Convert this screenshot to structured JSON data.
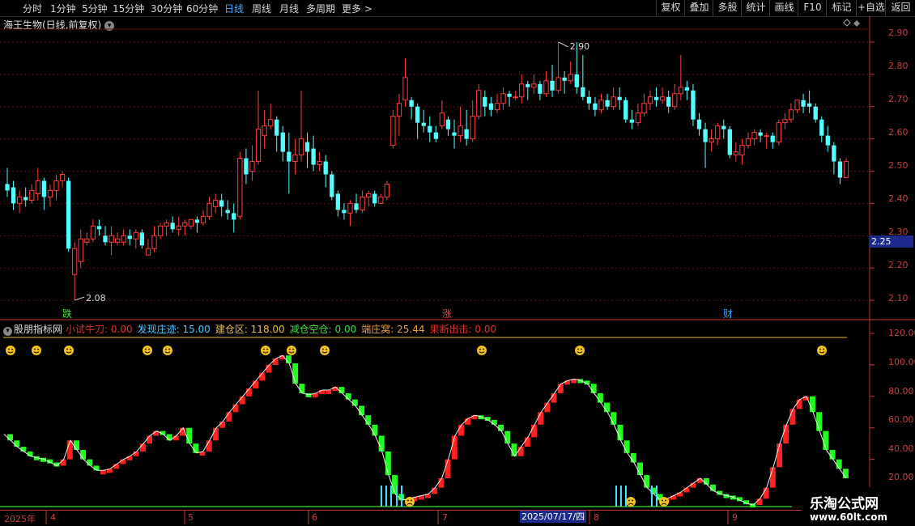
{
  "toolbar": {
    "periods": [
      "分时",
      "1分钟",
      "5分钟",
      "15分钟",
      "30分钟",
      "60分钟",
      "日线",
      "周线",
      "月线",
      "多周期",
      "更多 >"
    ],
    "active_period": "日线",
    "right_buttons": [
      "复权",
      "叠加",
      "多股",
      "统计",
      "画线",
      "F10",
      "标记",
      "+自选",
      "返回"
    ]
  },
  "stock_title": "海王生物(日线,前复权)",
  "price_axis": {
    "labels": [
      "2.90",
      "2.80",
      "2.70",
      "2.60",
      "2.50",
      "2.40",
      "2.30",
      "2.20",
      "2.10"
    ],
    "current_price": "2.25",
    "high_annotation": "2.90",
    "low_annotation": "2.08"
  },
  "markers": {
    "die": "跌",
    "zhang": "涨",
    "cai": "财"
  },
  "indicator": {
    "name": "股朋指标网",
    "items": [
      {
        "label": "小试牛刀: 0.00",
        "color": "#e03030"
      },
      {
        "label": "发现庄迹: 15.00",
        "color": "#4ac8ff"
      },
      {
        "label": "建仓区: 118.00",
        "color": "#e8c040"
      },
      {
        "label": "减仓空仓: 0.00",
        "color": "#40e040"
      },
      {
        "label": "端庄窝: 25.44",
        "color": "#e8a040"
      },
      {
        "label": "果断出击: 0.00",
        "color": "#e03030"
      }
    ],
    "axis_labels": [
      "120.00",
      "100.00",
      "80.00",
      "60.00",
      "40.00",
      "20.00"
    ]
  },
  "date_axis": {
    "labels": [
      "2025年",
      "4",
      "5",
      "6",
      "7",
      "8",
      "9"
    ],
    "highlight": "2025/07/17/四"
  },
  "watermark": {
    "line1": "乐淘公式网",
    "line2": "www.60lt.com"
  },
  "colors": {
    "up": "#ff3c3c",
    "down": "#54ffff",
    "bg": "#000000",
    "grid": "#5a1010",
    "ind_up": "#ff2020",
    "ind_down": "#20ff20"
  },
  "chart_data": {
    "type": "candlestick",
    "ylim": [
      2.06,
      2.94
    ],
    "candles": [
      [
        2.46,
        2.44,
        2.51,
        2.42
      ],
      [
        2.45,
        2.4,
        2.47,
        2.38
      ],
      [
        2.4,
        2.42,
        2.44,
        2.37
      ],
      [
        2.42,
        2.41,
        2.45,
        2.39
      ],
      [
        2.41,
        2.44,
        2.46,
        2.4
      ],
      [
        2.43,
        2.47,
        2.51,
        2.41
      ],
      [
        2.47,
        2.42,
        2.48,
        2.38
      ],
      [
        2.42,
        2.44,
        2.46,
        2.39
      ],
      [
        2.44,
        2.47,
        2.49,
        2.41
      ],
      [
        2.47,
        2.49,
        2.5,
        2.45
      ],
      [
        2.47,
        2.26,
        2.48,
        2.25
      ],
      [
        2.18,
        2.26,
        2.28,
        2.1
      ],
      [
        2.22,
        2.29,
        2.32,
        2.2
      ],
      [
        2.28,
        2.29,
        2.31,
        2.27
      ],
      [
        2.29,
        2.33,
        2.35,
        2.28
      ],
      [
        2.33,
        2.32,
        2.35,
        2.3
      ],
      [
        2.3,
        2.28,
        2.33,
        2.27
      ],
      [
        2.28,
        2.3,
        2.33,
        2.24
      ],
      [
        2.28,
        2.29,
        2.31,
        2.27
      ],
      [
        2.28,
        2.3,
        2.32,
        2.27
      ],
      [
        2.3,
        2.29,
        2.32,
        2.27
      ],
      [
        2.29,
        2.31,
        2.32,
        2.26
      ],
      [
        2.31,
        2.27,
        2.32,
        2.26
      ],
      [
        2.24,
        2.26,
        2.29,
        2.24
      ],
      [
        2.26,
        2.3,
        2.33,
        2.25
      ],
      [
        2.3,
        2.33,
        2.34,
        2.29
      ],
      [
        2.33,
        2.34,
        2.35,
        2.3
      ],
      [
        2.34,
        2.32,
        2.36,
        2.31
      ],
      [
        2.32,
        2.33,
        2.36,
        2.3
      ],
      [
        2.33,
        2.34,
        2.35,
        2.3
      ],
      [
        2.33,
        2.35,
        2.35,
        2.32
      ],
      [
        2.35,
        2.34,
        2.36,
        2.31
      ],
      [
        2.34,
        2.36,
        2.38,
        2.33
      ],
      [
        2.36,
        2.4,
        2.42,
        2.35
      ],
      [
        2.39,
        2.41,
        2.43,
        2.37
      ],
      [
        2.41,
        2.39,
        2.43,
        2.36
      ],
      [
        2.38,
        2.37,
        2.41,
        2.35
      ],
      [
        2.37,
        2.35,
        2.4,
        2.31
      ],
      [
        2.36,
        2.54,
        2.56,
        2.35
      ],
      [
        2.54,
        2.49,
        2.57,
        2.46
      ],
      [
        2.5,
        2.53,
        2.58,
        2.47
      ],
      [
        2.53,
        2.63,
        2.75,
        2.52
      ],
      [
        2.61,
        2.64,
        2.69,
        2.57
      ],
      [
        2.64,
        2.66,
        2.71,
        2.63
      ],
      [
        2.66,
        2.61,
        2.67,
        2.56
      ],
      [
        2.62,
        2.56,
        2.64,
        2.53
      ],
      [
        2.56,
        2.53,
        2.62,
        2.43
      ],
      [
        2.53,
        2.55,
        2.6,
        2.49
      ],
      [
        2.55,
        2.6,
        2.75,
        2.53
      ],
      [
        2.59,
        2.56,
        2.62,
        2.51
      ],
      [
        2.57,
        2.52,
        2.61,
        2.5
      ],
      [
        2.52,
        2.53,
        2.56,
        2.5
      ],
      [
        2.53,
        2.49,
        2.55,
        2.45
      ],
      [
        2.49,
        2.42,
        2.5,
        2.41
      ],
      [
        2.43,
        2.38,
        2.44,
        2.36
      ],
      [
        2.38,
        2.37,
        2.4,
        2.35
      ],
      [
        2.37,
        2.4,
        2.41,
        2.33
      ],
      [
        2.4,
        2.38,
        2.43,
        2.37
      ],
      [
        2.38,
        2.42,
        2.44,
        2.37
      ],
      [
        2.42,
        2.43,
        2.44,
        2.39
      ],
      [
        2.43,
        2.4,
        2.44,
        2.39
      ],
      [
        2.4,
        2.42,
        2.43,
        2.4
      ],
      [
        2.42,
        2.46,
        2.47,
        2.41
      ],
      [
        2.58,
        2.67,
        2.69,
        2.57
      ],
      [
        2.67,
        2.71,
        2.74,
        2.61
      ],
      [
        2.72,
        2.79,
        2.85,
        2.7
      ],
      [
        2.72,
        2.7,
        2.73,
        2.66
      ],
      [
        2.7,
        2.65,
        2.71,
        2.6
      ],
      [
        2.65,
        2.64,
        2.69,
        2.62
      ],
      [
        2.64,
        2.62,
        2.67,
        2.59
      ],
      [
        2.62,
        2.6,
        2.64,
        2.59
      ],
      [
        2.64,
        2.68,
        2.72,
        2.63
      ],
      [
        2.66,
        2.63,
        2.67,
        2.61
      ],
      [
        2.62,
        2.61,
        2.66,
        2.57
      ],
      [
        2.61,
        2.64,
        2.7,
        2.59
      ],
      [
        2.63,
        2.6,
        2.69,
        2.58
      ],
      [
        2.6,
        2.67,
        2.72,
        2.59
      ],
      [
        2.67,
        2.75,
        2.77,
        2.66
      ],
      [
        2.73,
        2.7,
        2.75,
        2.67
      ],
      [
        2.71,
        2.69,
        2.73,
        2.67
      ],
      [
        2.69,
        2.71,
        2.74,
        2.68
      ],
      [
        2.71,
        2.74,
        2.76,
        2.69
      ],
      [
        2.74,
        2.73,
        2.75,
        2.7
      ],
      [
        2.73,
        2.73,
        2.75,
        2.72
      ],
      [
        2.73,
        2.77,
        2.8,
        2.71
      ],
      [
        2.77,
        2.76,
        2.78,
        2.72
      ],
      [
        2.76,
        2.77,
        2.8,
        2.74
      ],
      [
        2.77,
        2.74,
        2.78,
        2.72
      ],
      [
        2.74,
        2.78,
        2.81,
        2.73
      ],
      [
        2.78,
        2.75,
        2.83,
        2.73
      ],
      [
        2.75,
        2.79,
        2.9,
        2.74
      ],
      [
        2.79,
        2.78,
        2.81,
        2.74
      ],
      [
        2.78,
        2.8,
        2.84,
        2.77
      ],
      [
        2.8,
        2.76,
        2.9,
        2.74
      ],
      [
        2.76,
        2.73,
        2.86,
        2.72
      ],
      [
        2.73,
        2.71,
        2.75,
        2.69
      ],
      [
        2.71,
        2.69,
        2.73,
        2.67
      ],
      [
        2.69,
        2.72,
        2.74,
        2.68
      ],
      [
        2.72,
        2.7,
        2.74,
        2.69
      ],
      [
        2.7,
        2.73,
        2.76,
        2.69
      ],
      [
        2.73,
        2.72,
        2.76,
        2.69
      ],
      [
        2.72,
        2.66,
        2.73,
        2.65
      ],
      [
        2.66,
        2.65,
        2.69,
        2.63
      ],
      [
        2.65,
        2.68,
        2.71,
        2.64
      ],
      [
        2.68,
        2.71,
        2.74,
        2.67
      ],
      [
        2.71,
        2.73,
        2.75,
        2.69
      ],
      [
        2.73,
        2.72,
        2.76,
        2.7
      ],
      [
        2.72,
        2.73,
        2.76,
        2.71
      ],
      [
        2.73,
        2.7,
        2.75,
        2.68
      ],
      [
        2.7,
        2.74,
        2.77,
        2.69
      ],
      [
        2.74,
        2.76,
        2.86,
        2.72
      ],
      [
        2.76,
        2.75,
        2.78,
        2.72
      ],
      [
        2.75,
        2.66,
        2.77,
        2.64
      ],
      [
        2.66,
        2.63,
        2.68,
        2.61
      ],
      [
        2.63,
        2.59,
        2.65,
        2.51
      ],
      [
        2.59,
        2.6,
        2.63,
        2.56
      ],
      [
        2.6,
        2.64,
        2.65,
        2.58
      ],
      [
        2.64,
        2.63,
        2.66,
        2.6
      ],
      [
        2.63,
        2.55,
        2.64,
        2.54
      ],
      [
        2.55,
        2.56,
        2.59,
        2.53
      ],
      [
        2.55,
        2.58,
        2.6,
        2.52
      ],
      [
        2.58,
        2.6,
        2.62,
        2.57
      ],
      [
        2.6,
        2.62,
        2.63,
        2.58
      ],
      [
        2.62,
        2.61,
        2.63,
        2.59
      ],
      [
        2.61,
        2.61,
        2.62,
        2.57
      ],
      [
        2.61,
        2.59,
        2.62,
        2.57
      ],
      [
        2.59,
        2.65,
        2.66,
        2.58
      ],
      [
        2.65,
        2.66,
        2.68,
        2.63
      ],
      [
        2.66,
        2.69,
        2.71,
        2.65
      ],
      [
        2.69,
        2.72,
        2.72,
        2.68
      ],
      [
        2.72,
        2.7,
        2.74,
        2.68
      ],
      [
        2.71,
        2.7,
        2.75,
        2.68
      ],
      [
        2.7,
        2.66,
        2.71,
        2.65
      ],
      [
        2.66,
        2.61,
        2.67,
        2.59
      ],
      [
        2.61,
        2.58,
        2.64,
        2.56
      ],
      [
        2.58,
        2.53,
        2.59,
        2.49
      ],
      [
        2.53,
        2.48,
        2.54,
        2.46
      ],
      [
        2.48,
        2.53,
        2.54,
        2.48
      ]
    ],
    "indicator_series": [
      56,
      52,
      48,
      45,
      42,
      41,
      40,
      38,
      36,
      40,
      52,
      46,
      40,
      36,
      33,
      33,
      34,
      37,
      40,
      42,
      45,
      50,
      55,
      58,
      56,
      52,
      55,
      60,
      50,
      44,
      45,
      52,
      60,
      64,
      70,
      75,
      80,
      85,
      90,
      95,
      100,
      104,
      106,
      101,
      88,
      82,
      81,
      82,
      84,
      84,
      86,
      82,
      78,
      74,
      68,
      62,
      55,
      45,
      30,
      18,
      14,
      15,
      16,
      17,
      18,
      22,
      28,
      40,
      55,
      62,
      66,
      68,
      67,
      65,
      62,
      58,
      50,
      42,
      48,
      54,
      62,
      70,
      76,
      82,
      88,
      90,
      91,
      90,
      88,
      82,
      76,
      70,
      62,
      52,
      44,
      38,
      30,
      22,
      18,
      14,
      15,
      17,
      19,
      22,
      25,
      28,
      24,
      20,
      18,
      17,
      16,
      14,
      12,
      11,
      15,
      22,
      35,
      50,
      62,
      72,
      78,
      80,
      70,
      58,
      46,
      40,
      34,
      28
    ]
  }
}
